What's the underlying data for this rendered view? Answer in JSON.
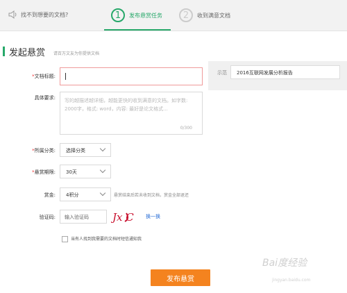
{
  "topbar": {
    "hint": "找不到想要的文档?",
    "steps": [
      {
        "number": "1",
        "label": "发布悬赏任务",
        "active": true
      },
      {
        "number": "2",
        "label": "收到满意文档",
        "active": false
      }
    ]
  },
  "section": {
    "title": "发起悬赏",
    "subtitle": "请百万文友为你提供文档"
  },
  "form": {
    "doc_title_label": "文档标题:",
    "doc_title_value": "",
    "example_label": "示范",
    "example_value": "2016互联网发展分析报告",
    "requirements_label": "具体要求:",
    "requirements_placeholder": "写的越描述越详细，越能更快的收到满意的文档。如字数: 2000字，格式: word，内容: 最好是论文格式...",
    "requirements_count": "0/300",
    "category_label": "所属分类:",
    "category_value": "选择分类",
    "deadline_label": "悬赏期限:",
    "deadline_value": "30天",
    "reward_label": "赏金:",
    "reward_value": "4积分",
    "reward_note": "悬赏结束后若未收到文档，赏金全部退还",
    "captcha_label": "验证码:",
    "captcha_placeholder": "输入验证码",
    "captcha_image_text": "Jx C",
    "captcha_refresh": "换一换",
    "notify_label": "当有人找到我需要的文档时短信通知我",
    "required_mark": "*"
  },
  "submit_label": "发布悬赏",
  "watermark": {
    "text": "Bai度经验",
    "sub": "jingyan.baidu.com"
  },
  "colors": {
    "accent": "#27a86a",
    "submit": "#f4831f",
    "error_border": "#f09a9a"
  }
}
